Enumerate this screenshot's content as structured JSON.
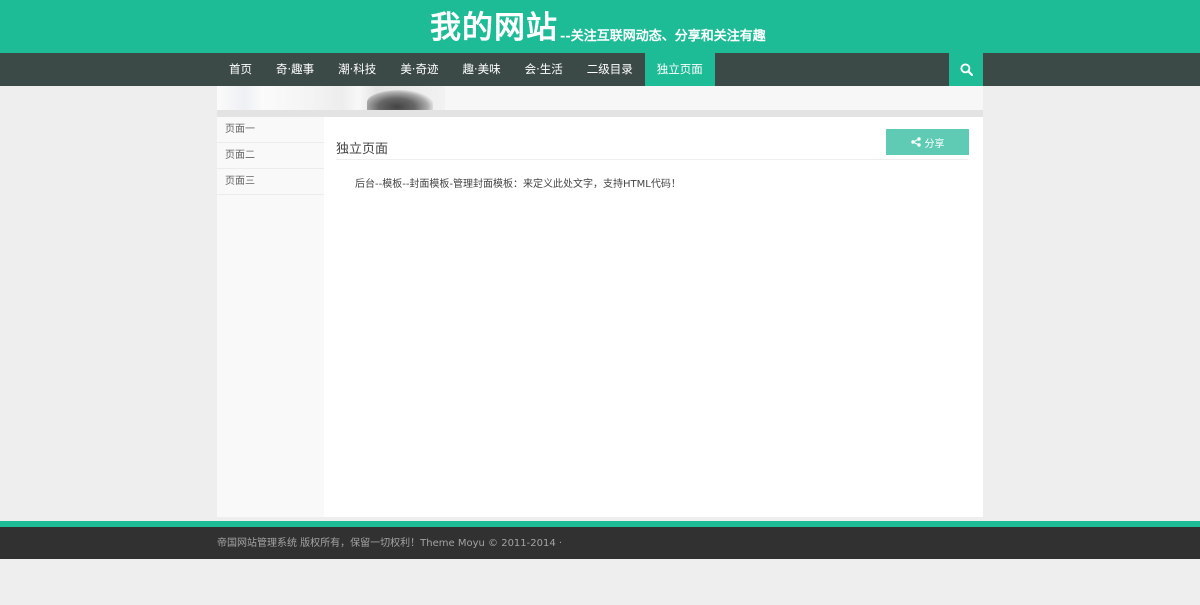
{
  "header": {
    "logo_title": "我的网站",
    "logo_tagline": "--关注互联网动态、分享和关注有趣"
  },
  "nav": {
    "items": [
      {
        "label": "首页"
      },
      {
        "label": "奇·趣事"
      },
      {
        "label": "潮·科技"
      },
      {
        "label": "美·奇迹"
      },
      {
        "label": "趣·美味"
      },
      {
        "label": "会·生活"
      },
      {
        "label": "二级目录"
      },
      {
        "label": "独立页面"
      }
    ],
    "active": "独立页面",
    "search_icon": "search-icon"
  },
  "sidebar": {
    "items": [
      {
        "label": "页面一"
      },
      {
        "label": "页面二"
      },
      {
        "label": "页面三"
      }
    ]
  },
  "content": {
    "title": "独立页面",
    "share_label": "分享",
    "share_icon": "share-icon",
    "body": "后台--模板--封面模板-管理封面模板：来定义此处文字，支持HTML代码！"
  },
  "footer": {
    "text": "帝国网站管理系统 版权所有，保留一切权利！Theme Moyu © 2011-2014 ·"
  },
  "colors": {
    "brand": "#1dbc97",
    "nav_bg": "#3c4a47",
    "share_button": "#5fcbb4",
    "footer_bg": "#313131"
  }
}
